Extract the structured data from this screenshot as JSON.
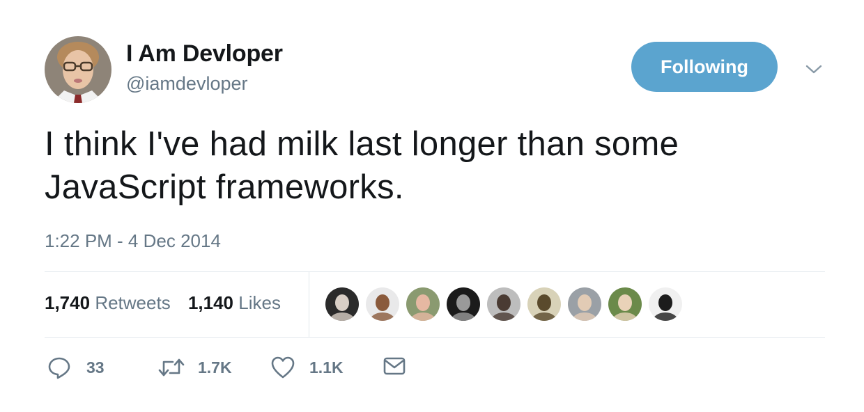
{
  "author": {
    "display_name": "I Am Devloper",
    "handle": "@iamdevloper"
  },
  "follow_button": {
    "label": "Following",
    "color": "#5ba4cf"
  },
  "tweet": {
    "text_line1": "I think I've had milk last longer than some",
    "text_line2": "JavaScript frameworks.",
    "timestamp": "1:22 PM - 4 Dec 2014"
  },
  "stats": {
    "retweets_count": "1,740",
    "retweets_label": "Retweets",
    "likes_count": "1,140",
    "likes_label": "Likes"
  },
  "likers": [
    {
      "name": "liker-avatar-1",
      "bg": "#2b2b2b",
      "fg": "#d9cfc6"
    },
    {
      "name": "liker-avatar-2",
      "bg": "#e9e9ea",
      "fg": "#8a5a3c"
    },
    {
      "name": "liker-avatar-3",
      "bg": "#8a9a70",
      "fg": "#e6b8a2"
    },
    {
      "name": "liker-avatar-4",
      "bg": "#1b1b1b",
      "fg": "#9a9a9a"
    },
    {
      "name": "liker-avatar-5",
      "bg": "#bdbdbd",
      "fg": "#4a3b33"
    },
    {
      "name": "liker-avatar-6",
      "bg": "#d8d2b8",
      "fg": "#5a4a2c"
    },
    {
      "name": "liker-avatar-7",
      "bg": "#9aa0a6",
      "fg": "#e2cbb5"
    },
    {
      "name": "liker-avatar-8",
      "bg": "#6b8a4a",
      "fg": "#e9d2b8"
    },
    {
      "name": "liker-avatar-9",
      "bg": "#f0f0f0",
      "fg": "#1c1c1c"
    }
  ],
  "actions": {
    "reply_count": "33",
    "retweet_count": "1.7K",
    "like_count": "1.1K"
  },
  "colors": {
    "text": "#14171a",
    "muted": "#657786",
    "divider": "#e1e8ed"
  }
}
